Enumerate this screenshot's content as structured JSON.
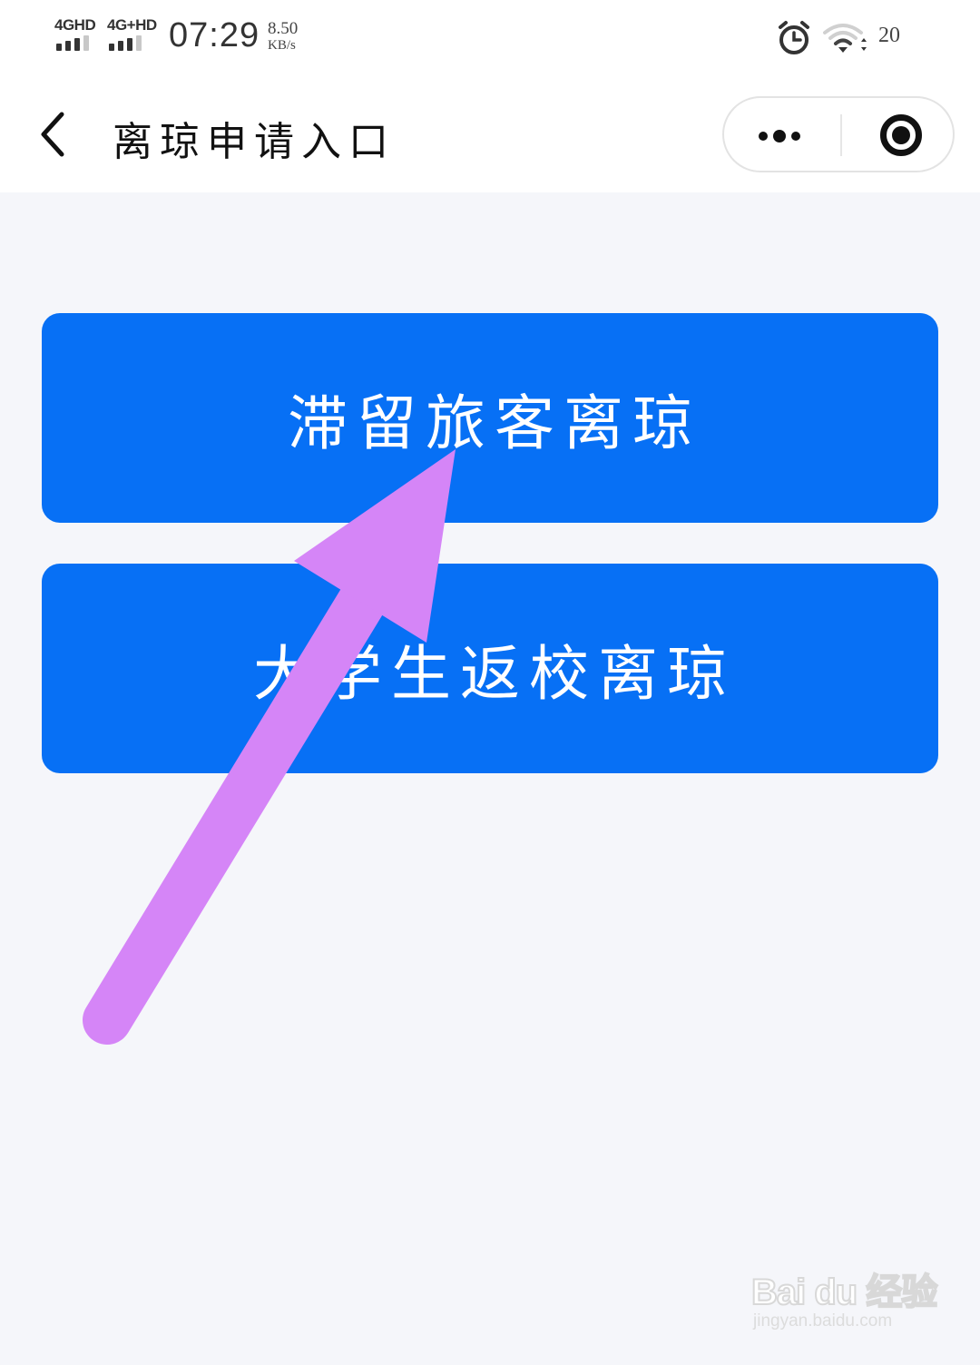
{
  "status_bar": {
    "signal_1_label": "4GHD",
    "signal_2_label": "4G+HD",
    "time": "07:29",
    "net_speed_value": "8.50",
    "net_speed_unit": "KB/s",
    "alarm_icon": "alarm-clock-icon",
    "wifi_icon": "wifi-icon",
    "battery": "20"
  },
  "nav_bar": {
    "back_icon": "chevron-left-icon",
    "title": "离琼申请入口",
    "more_icon": "more-dots-icon",
    "close_icon": "close-miniprogram-icon"
  },
  "entries": [
    {
      "label": "滞留旅客离琼"
    },
    {
      "label": "大学生返校离琼"
    }
  ],
  "annotation": {
    "arrow_color": "#d585f7"
  },
  "watermark": {
    "logo": "Bai du 经验",
    "url": "jingyan.baidu.com"
  },
  "colors": {
    "primary_button": "#0770f5",
    "page_background": "#f5f6fa",
    "bar_background": "#ffffff"
  }
}
